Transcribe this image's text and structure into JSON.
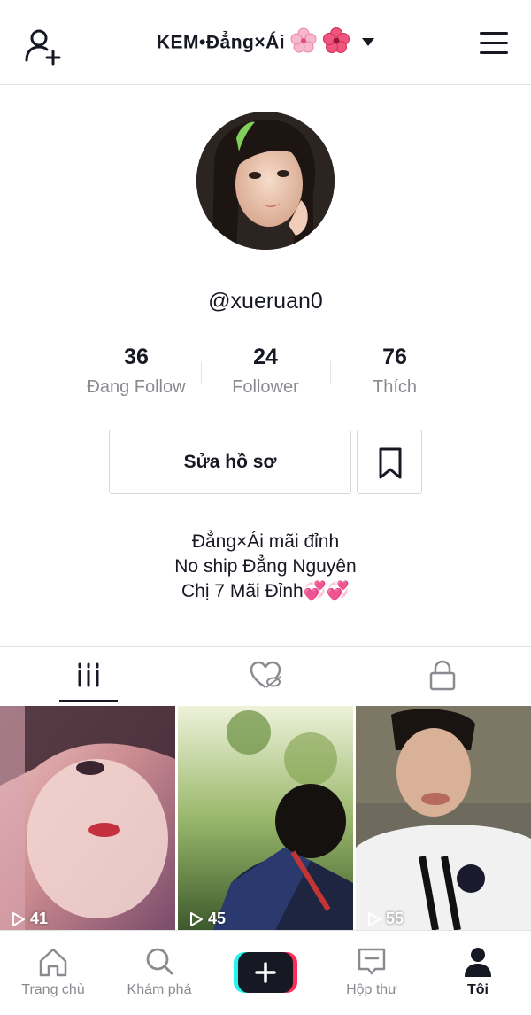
{
  "header": {
    "title": "KEM•Đẳng×Ái",
    "add_user_icon": "person-plus-icon",
    "menu_icon": "hamburger-menu-icon"
  },
  "profile": {
    "username": "@xueruan0",
    "stats": [
      {
        "value": "36",
        "label": "Đang Follow"
      },
      {
        "value": "24",
        "label": "Follower"
      },
      {
        "value": "76",
        "label": "Thích"
      }
    ],
    "edit_label": "Sửa hồ sơ",
    "bio_lines": [
      "Đẳng×Ái mãi đỉnh",
      "No ship Đẳng Nguyên",
      "Chị 7 Mãi Đỉnh💞💞"
    ]
  },
  "tabs": [
    {
      "icon": "grid-bars-icon",
      "active": true
    },
    {
      "icon": "hidden-heart-icon",
      "active": false
    },
    {
      "icon": "lock-icon",
      "active": false
    }
  ],
  "videos": [
    {
      "views": "41",
      "colors": [
        "#f2c6c6",
        "#c98a8f",
        "#7a4b6b"
      ]
    },
    {
      "views": "45",
      "colors": [
        "#c9d8a8",
        "#6f8f4a",
        "#2b3c2a"
      ]
    },
    {
      "views": "55",
      "colors": [
        "#8a8676",
        "#d8b79b",
        "#f2f2f2"
      ]
    }
  ],
  "bottom_nav": [
    {
      "label": "Trang chủ",
      "icon": "home-icon"
    },
    {
      "label": "Khám phá",
      "icon": "search-icon"
    },
    {
      "label": "",
      "icon": "plus-icon"
    },
    {
      "label": "Hộp thư",
      "icon": "inbox-icon"
    },
    {
      "label": "Tôi",
      "icon": "profile-icon",
      "active": true
    }
  ],
  "colors": {
    "accent_cyan": "#25f4ee",
    "accent_pink": "#fe2c55",
    "text": "#161823",
    "muted": "#8a8b91"
  }
}
